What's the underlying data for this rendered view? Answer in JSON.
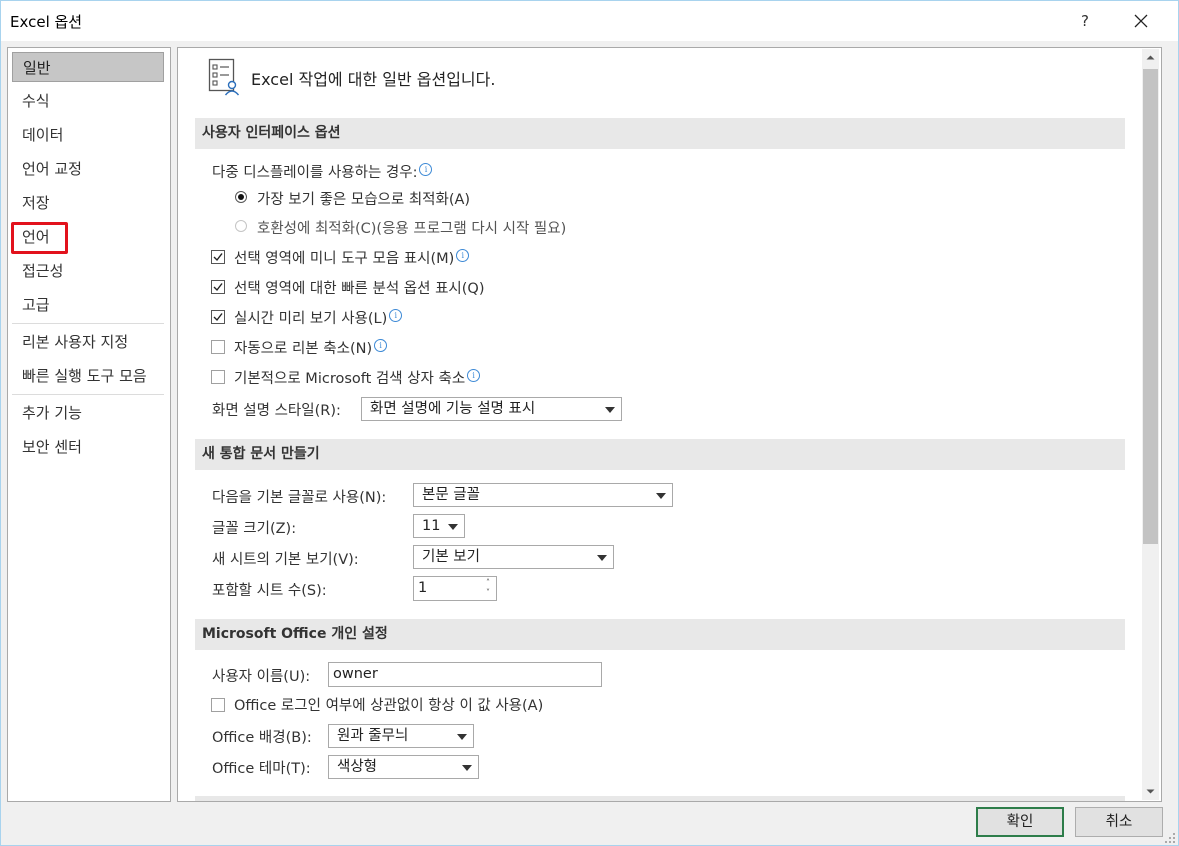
{
  "window": {
    "title": "Excel 옵션",
    "help_label": "?"
  },
  "colors": {
    "accent_border": "#2e7d4a",
    "highlight_box": "#e2121c",
    "info_icon": "#3e8ad6",
    "frame_border": "#a8d3ee"
  },
  "nav": {
    "items": [
      {
        "label": "일반",
        "selected": true
      },
      {
        "label": "수식"
      },
      {
        "label": "데이터"
      },
      {
        "label": "언어 교정"
      },
      {
        "label": "저장"
      },
      {
        "label": "언어",
        "highlighted": true
      },
      {
        "label": "접근성"
      },
      {
        "label": "고급"
      },
      {
        "label": "리본 사용자 지정"
      },
      {
        "label": "빠른 실행 도구 모음"
      },
      {
        "label": "추가 기능"
      },
      {
        "label": "보안 센터"
      }
    ]
  },
  "main": {
    "heading": "Excel 작업에 대한 일반 옵션입니다.",
    "ui_options": {
      "header": "사용자 인터페이스 옵션",
      "multi_display_label": "다중 디스플레이를 사용하는 경우:",
      "radio_optimize_best": "가장 보기 좋은 모습으로 최적화(A)",
      "radio_optimize_compat": "호환성에 최적화(C)(응용 프로그램 다시 시작 필요)",
      "chk_mini_toolbar": "선택 영역에 미니 도구 모음 표시(M)",
      "chk_quick_analysis": "선택 영역에 대한 빠른 분석 옵션 표시(Q)",
      "chk_live_preview": "실시간 미리 보기 사용(L)",
      "chk_collapse_ribbon": "자동으로 리본 축소(N)",
      "chk_collapse_search": "기본적으로 Microsoft 검색 상자 축소",
      "screentip_label": "화면 설명 스타일(R):",
      "screentip_value": "화면 설명에 기능 설명 표시"
    },
    "new_workbook": {
      "header": "새 통합 문서 만들기",
      "font_label": "다음을 기본 글꼴로 사용(N):",
      "font_value": "본문 글꼴",
      "size_label": "글꼴 크기(Z):",
      "size_value": "11",
      "view_label": "새 시트의 기본 보기(V):",
      "view_value": "기본 보기",
      "sheets_label": "포함할 시트 수(S):",
      "sheets_value": "1"
    },
    "personalize": {
      "header": "Microsoft Office 개인 설정",
      "username_label": "사용자 이름(U):",
      "username_value": "owner",
      "chk_always_use": "Office 로그인 여부에 상관없이 항상 이 값 사용(A)",
      "background_label": "Office 배경(B):",
      "background_value": "원과 줄무늬",
      "theme_label": "Office 테마(T):",
      "theme_value": "색상형"
    }
  },
  "footer": {
    "ok_label": "확인",
    "cancel_label": "취소"
  }
}
